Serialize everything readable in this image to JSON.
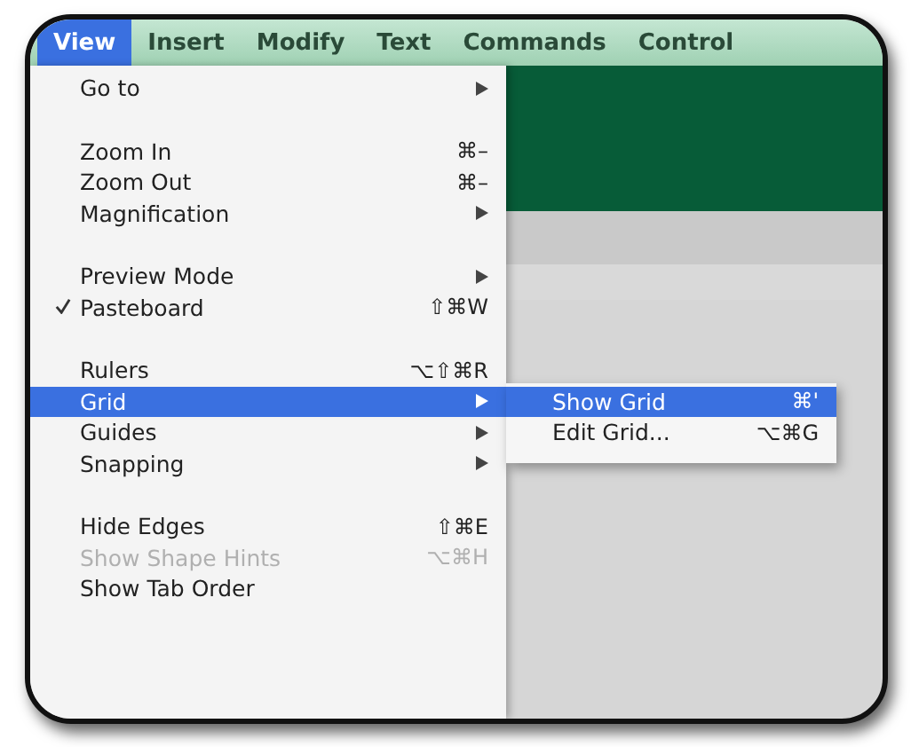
{
  "menubar": [
    {
      "label": "View",
      "selected": true
    },
    {
      "label": "Insert",
      "selected": false
    },
    {
      "label": "Modify",
      "selected": false
    },
    {
      "label": "Text",
      "selected": false
    },
    {
      "label": "Commands",
      "selected": false
    },
    {
      "label": "Control",
      "selected": false
    }
  ],
  "menu": [
    {
      "kind": "item",
      "label": "Go to",
      "submenu": true,
      "selected": false
    },
    {
      "kind": "separator"
    },
    {
      "kind": "item",
      "label": "Zoom In",
      "shortcut": "⌘–",
      "selected": false
    },
    {
      "kind": "item",
      "label": "Zoom Out",
      "shortcut": "⌘–",
      "selected": false
    },
    {
      "kind": "item",
      "label": "Magnification",
      "submenu": true,
      "selected": false
    },
    {
      "kind": "separator"
    },
    {
      "kind": "item",
      "label": "Preview Mode",
      "submenu": true,
      "selected": false
    },
    {
      "kind": "item",
      "label": "Pasteboard",
      "shortcut": "⇧⌘W",
      "checked": true,
      "selected": false
    },
    {
      "kind": "separator"
    },
    {
      "kind": "item",
      "label": "Rulers",
      "shortcut": "⌥⇧⌘R",
      "selected": false
    },
    {
      "kind": "item",
      "label": "Grid",
      "submenu": true,
      "selected": true
    },
    {
      "kind": "item",
      "label": "Guides",
      "submenu": true,
      "selected": false
    },
    {
      "kind": "item",
      "label": "Snapping",
      "submenu": true,
      "selected": false
    },
    {
      "kind": "separator"
    },
    {
      "kind": "item",
      "label": "Hide Edges",
      "shortcut": "⇧⌘E",
      "selected": false
    },
    {
      "kind": "item",
      "label": "Show Shape Hints",
      "shortcut": "⌥⌘H",
      "disabled": true,
      "selected": false
    },
    {
      "kind": "item",
      "label": "Show Tab Order",
      "selected": false
    }
  ],
  "submenu": [
    {
      "label": "Show Grid",
      "shortcut": "⌘'",
      "selected": true
    },
    {
      "label": "Edit Grid...",
      "shortcut": "⌥⌘G",
      "selected": false
    }
  ]
}
